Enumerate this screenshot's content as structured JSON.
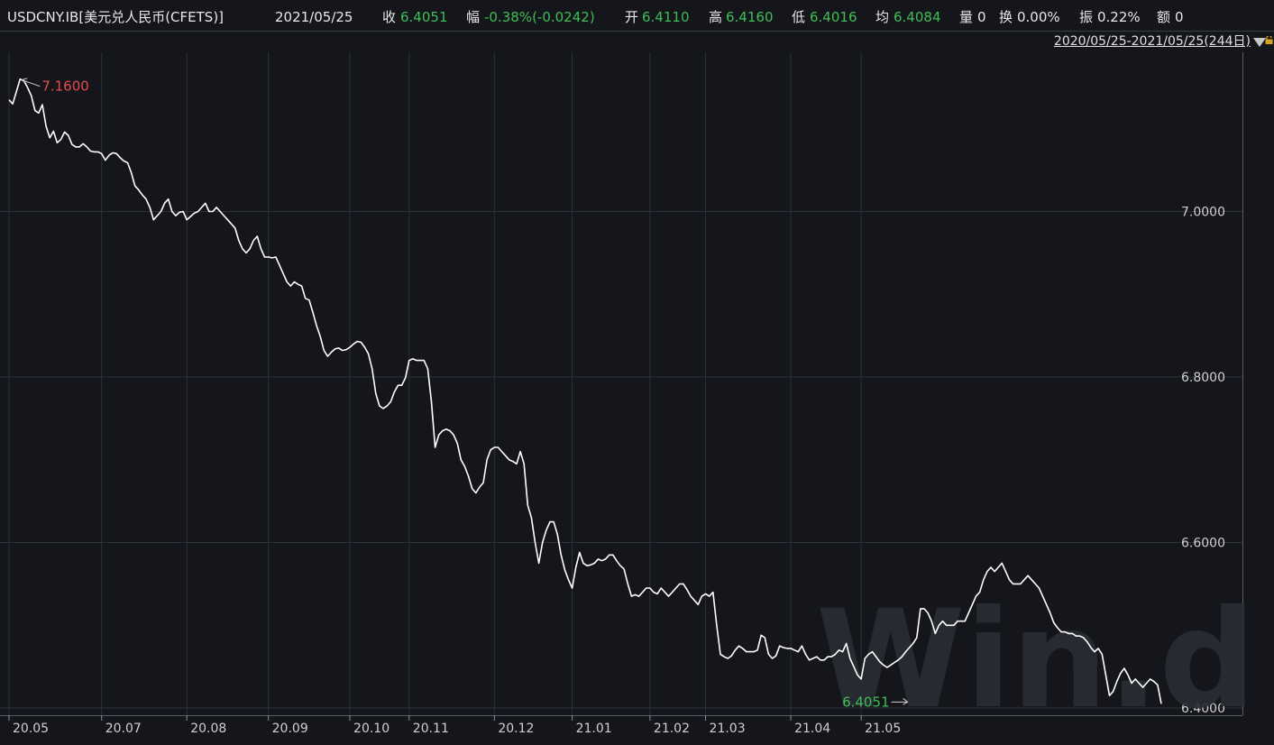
{
  "header": {
    "symbol": "USDCNY.IB[美元兑人民币(CFETS)]",
    "date": "2021/05/25",
    "close_label": "收",
    "close": "6.4051",
    "change_label": "幅",
    "change": "-0.38%(-0.0242)",
    "open_label": "开",
    "open": "6.4110",
    "high_label": "高",
    "high": "6.4160",
    "low_label": "低",
    "low": "6.4016",
    "avg_label": "均",
    "avg": "6.4084",
    "volume_label": "量",
    "volume": "0",
    "turnover_label": "换",
    "turnover": "0.00%",
    "amplitude_label": "振",
    "amplitude": "0.22%",
    "amount_label": "额",
    "amount": "0"
  },
  "range_selector": {
    "text": "2020/05/25-2021/05/25(244日)",
    "icons": [
      "dropdown-triangle-icon",
      "lock-icon"
    ]
  },
  "watermark": "Win.d",
  "colors": {
    "background": "#14161c",
    "line": "#ffffff",
    "grid": "#33363d",
    "high_label": "#e84b4b",
    "low_label": "#3fbe54"
  },
  "chart_data": {
    "type": "line",
    "title": "",
    "xlabel": "",
    "ylabel": "",
    "ylim": [
      6.4,
      7.2
    ],
    "y_ticks": [
      "7.0000",
      "6.8000",
      "6.6000",
      "6.4000"
    ],
    "x_ticks": [
      "20.05",
      "20.07",
      "20.08",
      "20.09",
      "20.10",
      "20.11",
      "20.12",
      "21.01",
      "21.02",
      "21.03",
      "21.04",
      "21.05"
    ],
    "x_tick_index": [
      0,
      25,
      48,
      70,
      92,
      108,
      131,
      152,
      173,
      188,
      211,
      230
    ],
    "grid": true,
    "annotations": [
      {
        "label": "7.1600",
        "index": 3,
        "value": 7.16,
        "kind": "max"
      },
      {
        "label": "6.4051",
        "index": 243,
        "value": 6.4051,
        "kind": "last"
      }
    ],
    "series": [
      {
        "values": [
          7.135,
          7.13,
          7.145,
          7.16,
          7.158,
          7.15,
          7.14,
          7.122,
          7.119,
          7.129,
          7.103,
          7.089,
          7.097,
          7.083,
          7.087,
          7.096,
          7.092,
          7.081,
          7.078,
          7.078,
          7.082,
          7.078,
          7.073,
          7.072,
          7.072,
          7.07,
          7.062,
          7.068,
          7.071,
          7.07,
          7.065,
          7.061,
          7.059,
          7.047,
          7.031,
          7.026,
          7.02,
          7.015,
          7.005,
          6.99,
          6.995,
          7.0,
          7.01,
          7.015,
          7.0,
          6.995,
          6.999,
          7.0,
          6.99,
          6.994,
          6.998,
          7.0,
          7.005,
          7.01,
          7.0,
          7.0,
          7.005,
          7.0,
          6.995,
          6.99,
          6.985,
          6.98,
          6.965,
          6.955,
          6.95,
          6.955,
          6.965,
          6.97,
          6.955,
          6.945,
          6.945,
          6.944,
          6.945,
          6.935,
          6.925,
          6.915,
          6.91,
          6.915,
          6.912,
          6.91,
          6.895,
          6.893,
          6.878,
          6.862,
          6.849,
          6.832,
          6.825,
          6.83,
          6.834,
          6.835,
          6.832,
          6.833,
          6.836,
          6.84,
          6.843,
          6.842,
          6.836,
          6.828,
          6.81,
          6.78,
          6.765,
          6.762,
          6.765,
          6.77,
          6.782,
          6.79,
          6.79,
          6.799,
          6.82,
          6.822,
          6.82,
          6.82,
          6.82,
          6.81,
          6.77,
          6.715,
          6.73,
          6.735,
          6.737,
          6.735,
          6.73,
          6.72,
          6.7,
          6.692,
          6.68,
          6.665,
          6.66,
          6.667,
          6.672,
          6.7,
          6.712,
          6.715,
          6.715,
          6.71,
          6.705,
          6.7,
          6.698,
          6.695,
          6.71,
          6.695,
          6.645,
          6.63,
          6.6,
          6.575,
          6.6,
          6.615,
          6.625,
          6.625,
          6.61,
          6.585,
          6.567,
          6.555,
          6.545,
          6.57,
          6.588,
          6.575,
          6.572,
          6.573,
          6.575,
          6.58,
          6.578,
          6.58,
          6.585,
          6.585,
          6.578,
          6.572,
          6.568,
          6.55,
          6.535,
          6.537,
          6.535,
          6.54,
          6.545,
          6.545,
          6.54,
          6.538,
          6.545,
          6.54,
          6.535,
          6.54,
          6.545,
          6.55,
          6.55,
          6.543,
          6.535,
          6.53,
          6.525,
          6.535,
          6.538,
          6.535,
          6.54,
          6.5,
          6.465,
          6.462,
          6.46,
          6.463,
          6.47,
          6.475,
          6.472,
          6.468,
          6.468,
          6.468,
          6.47,
          6.488,
          6.485,
          6.465,
          6.46,
          6.463,
          6.475,
          6.473,
          6.472,
          6.472,
          6.47,
          6.468,
          6.475,
          6.465,
          6.458,
          6.46,
          6.462,
          6.458,
          6.458,
          6.462,
          6.462,
          6.465,
          6.47,
          6.468,
          6.478,
          6.46,
          6.45,
          6.44,
          6.435,
          6.46,
          6.465,
          6.468,
          6.462,
          6.456,
          6.452,
          6.449,
          6.452,
          6.455,
          6.458,
          6.462,
          6.468,
          6.473,
          6.478,
          6.485,
          6.52,
          6.52,
          6.515,
          6.505,
          6.49,
          6.5,
          6.505,
          6.5,
          6.5,
          6.5,
          6.505,
          6.505,
          6.505,
          6.515,
          6.525,
          6.535,
          6.54,
          6.555,
          6.565,
          6.57,
          6.565,
          6.57,
          6.575,
          6.565,
          6.555,
          6.55,
          6.55,
          6.55,
          6.555,
          6.56,
          6.555,
          6.55,
          6.545,
          6.535,
          6.525,
          6.515,
          6.503,
          6.497,
          6.492,
          6.492,
          6.49,
          6.49,
          6.487,
          6.487,
          6.485,
          6.48,
          6.473,
          6.468,
          6.472,
          6.465,
          6.44,
          6.415,
          6.42,
          6.432,
          6.442,
          6.448,
          6.44,
          6.43,
          6.435,
          6.43,
          6.425,
          6.43,
          6.435,
          6.432,
          6.428,
          6.4051
        ]
      }
    ]
  }
}
